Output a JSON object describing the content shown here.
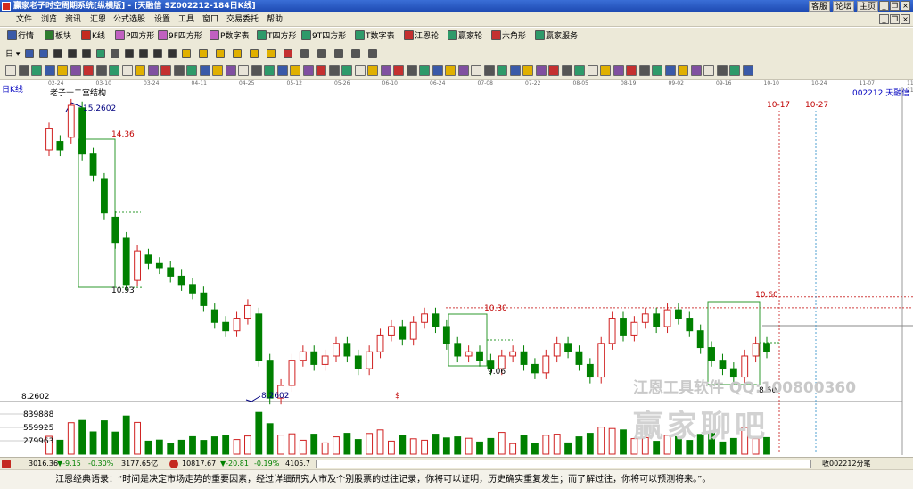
{
  "window": {
    "title": "赢家老子时空周期系统[纵横版] - [天融信   SZ002212-184日K线]",
    "links": [
      "客服",
      "论坛",
      "主页"
    ],
    "controls": [
      "_",
      "❐",
      "×"
    ]
  },
  "menu": [
    "文件",
    "浏览",
    "资讯",
    "汇恩",
    "公式选股",
    "设置",
    "工具",
    "窗口",
    "交易委托",
    "帮助"
  ],
  "toolbar1": [
    {
      "label": "行情",
      "icon": "quote-icon",
      "color": "#3a5aa8"
    },
    {
      "label": "板块",
      "icon": "sector-icon",
      "color": "#2f7d2f"
    },
    {
      "label": "K线",
      "icon": "kline-icon",
      "color": "#c42a20"
    },
    {
      "label": "P四方形",
      "icon": "p-square-icon",
      "color": "#c060c0"
    },
    {
      "label": "9F四方形",
      "icon": "9f-square-icon",
      "color": "#c060c0"
    },
    {
      "label": "P数字表",
      "icon": "p-number-icon",
      "color": "#c060c0"
    },
    {
      "label": "T四方形",
      "icon": "t-square-icon",
      "color": "#2e9a6a"
    },
    {
      "label": "9T四方形",
      "icon": "9t-square-icon",
      "color": "#2e9a6a"
    },
    {
      "label": "T数字表",
      "icon": "t-number-icon",
      "color": "#2e9a6a"
    },
    {
      "label": "江恩轮",
      "icon": "gann-wheel-icon",
      "color": "#c43030"
    },
    {
      "label": "赢家轮",
      "icon": "winner-wheel-icon",
      "color": "#2e9a6a"
    },
    {
      "label": "六角形",
      "icon": "hexagon-icon",
      "color": "#c43030"
    },
    {
      "label": "赢家服务",
      "icon": "service-icon",
      "color": "#2e9a6a"
    }
  ],
  "toolbar2": [
    {
      "label": "日 ▾",
      "icon": "period-select"
    },
    {
      "label": "",
      "icon": "zoom-in-icon"
    },
    {
      "label": "",
      "icon": "zoom-out-icon"
    },
    {
      "label": "",
      "icon": "left-icon"
    },
    {
      "label": "",
      "icon": "right-icon"
    },
    {
      "label": "",
      "icon": "move-icon"
    },
    {
      "label": "",
      "icon": "refresh-icon"
    },
    {
      "label": "",
      "icon": "grid-icon"
    },
    {
      "label": "",
      "icon": "play-icon"
    },
    {
      "label": "",
      "icon": "end-icon"
    },
    {
      "label": "",
      "icon": "prev-icon"
    },
    {
      "label": "",
      "icon": "next-icon"
    },
    {
      "label": "",
      "icon": "diamond-icon"
    },
    {
      "label": "",
      "icon": "diamond-icon"
    },
    {
      "label": "",
      "icon": "diamond-icon"
    },
    {
      "label": "",
      "icon": "diamond-icon"
    },
    {
      "label": "",
      "icon": "diamond-icon"
    },
    {
      "label": "",
      "icon": "diamond-icon"
    },
    {
      "label": "",
      "icon": "box-icon"
    },
    {
      "label": "",
      "icon": "box-icon"
    },
    {
      "label": "",
      "icon": "box-icon"
    },
    {
      "label": "",
      "icon": "box-icon"
    },
    {
      "label": "",
      "icon": "box-icon"
    },
    {
      "label": "",
      "icon": "box-icon"
    }
  ],
  "chart": {
    "period_label": "日K线",
    "indicator_label": "老子十二宫结构",
    "stock_label": "002212  天融信",
    "date_ticks": [
      "02-24",
      "03-10",
      "03-24",
      "04-11",
      "04-25",
      "05-12",
      "05-26",
      "06-10",
      "06-24",
      "07-08",
      "07-22",
      "08-05",
      "08-19",
      "09-02",
      "09-16",
      "10-10",
      "10-24",
      "11-07",
      "11-21"
    ],
    "price_labels": {
      "high": "15.2602",
      "low": "8.2602",
      "low_axis": "8.2602",
      "p1436": "14.36",
      "p1093": "10.93",
      "p1030": "10.30",
      "p906": "9.06",
      "p1060": "10.60",
      "p860": "8.60"
    },
    "future_dates": [
      "10-17",
      "10-27"
    ],
    "volume_ticks": [
      "839888",
      "559925",
      "279963"
    ],
    "dollar_mark": "$"
  },
  "watermark": {
    "line1": "江恩工具软件  QQ:100800360",
    "line2": "赢家聊吧"
  },
  "status": {
    "sh_index": "3016.36",
    "sh_change": "▼-9.15",
    "sh_pct": "-0.30%",
    "sh_vol": "3177.65亿",
    "sz_index": "10817.67",
    "sz_change": "▼-20.81",
    "sz_pct": "-0.19%",
    "sz_vol": "4105.7",
    "right": "收002212分笔"
  },
  "quote": "江恩经典语录：“时间是决定市场走势的重要因素，经过详细研究大市及个别股票的过往记录，你将可以证明，历史确实重复发生；而了解过往，你将可以预测将来。”。",
  "chart_data": {
    "type": "candlestick",
    "y_axis_ticks": [
      "8.2602"
    ],
    "levels": [
      15.2602,
      14.36,
      10.93,
      10.3,
      9.06,
      10.6,
      8.6,
      8.2602
    ],
    "candles_approx": [
      [
        14.2,
        14.7
      ],
      [
        14.4,
        14.2
      ],
      [
        14.5,
        15.26
      ],
      [
        15.2,
        14.1
      ],
      [
        14.1,
        13.6
      ],
      [
        13.5,
        12.7
      ],
      [
        12.6,
        12.0
      ],
      [
        12.1,
        11.0
      ],
      [
        11.1,
        11.8
      ],
      [
        11.7,
        11.5
      ],
      [
        11.5,
        11.4
      ],
      [
        11.4,
        11.2
      ],
      [
        11.2,
        11.0
      ],
      [
        11.0,
        10.8
      ],
      [
        10.8,
        10.5
      ],
      [
        10.4,
        10.1
      ],
      [
        10.1,
        9.9
      ],
      [
        9.9,
        10.2
      ],
      [
        10.2,
        10.5
      ],
      [
        10.3,
        9.2
      ],
      [
        9.2,
        8.3
      ],
      [
        8.3,
        8.6
      ],
      [
        8.6,
        9.2
      ],
      [
        9.2,
        9.4
      ],
      [
        9.4,
        9.1
      ],
      [
        9.1,
        9.3
      ],
      [
        9.3,
        9.6
      ],
      [
        9.6,
        9.3
      ],
      [
        9.3,
        9.0
      ],
      [
        9.0,
        9.4
      ],
      [
        9.4,
        9.8
      ],
      [
        9.8,
        10.0
      ],
      [
        10.0,
        9.7
      ],
      [
        9.7,
        10.1
      ],
      [
        10.1,
        10.3
      ],
      [
        10.3,
        10.0
      ],
      [
        10.0,
        9.6
      ],
      [
        9.6,
        9.3
      ],
      [
        9.3,
        9.4
      ],
      [
        9.4,
        9.2
      ],
      [
        9.2,
        9.0
      ],
      [
        9.0,
        9.3
      ],
      [
        9.3,
        9.4
      ],
      [
        9.4,
        9.1
      ],
      [
        9.1,
        8.9
      ],
      [
        8.9,
        9.3
      ],
      [
        9.3,
        9.6
      ],
      [
        9.6,
        9.4
      ],
      [
        9.4,
        9.1
      ],
      [
        9.1,
        8.8
      ],
      [
        8.8,
        9.6
      ],
      [
        9.6,
        10.2
      ],
      [
        10.2,
        9.8
      ],
      [
        9.8,
        10.1
      ],
      [
        10.1,
        10.3
      ],
      [
        10.3,
        10.0
      ],
      [
        10.0,
        10.4
      ],
      [
        10.4,
        10.2
      ],
      [
        10.2,
        9.9
      ],
      [
        9.9,
        9.5
      ],
      [
        9.5,
        9.2
      ],
      [
        9.2,
        9.0
      ],
      [
        9.0,
        8.8
      ],
      [
        8.8,
        9.3
      ],
      [
        9.3,
        9.6
      ],
      [
        9.6,
        9.4
      ]
    ]
  }
}
